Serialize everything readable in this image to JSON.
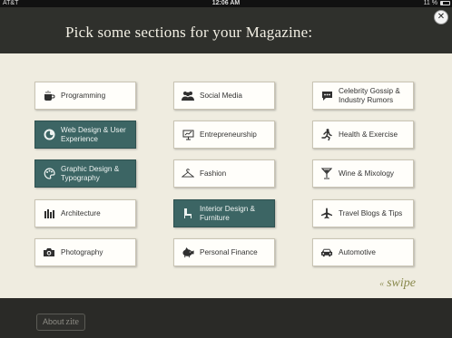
{
  "status_bar": {
    "carrier": "AT&T",
    "time": "12:06 AM",
    "battery": "11 %"
  },
  "header": {
    "title": "Pick some sections for your Magazine:",
    "close_label": "✕"
  },
  "sections": [
    {
      "label": "Programming",
      "selected": false,
      "icon": "coffee-icon"
    },
    {
      "label": "Social Media",
      "selected": false,
      "icon": "people-icon"
    },
    {
      "label": "Celebrity Gossip & Industry Rumors",
      "selected": false,
      "icon": "speech-bubble-icon"
    },
    {
      "label": "Web Design & User Experience",
      "selected": true,
      "icon": "firefox-icon"
    },
    {
      "label": "Entrepreneurship",
      "selected": false,
      "icon": "presentation-board-icon"
    },
    {
      "label": "Health & Exercise",
      "selected": false,
      "icon": "running-man-icon"
    },
    {
      "label": "Graphic Design & Typography",
      "selected": true,
      "icon": "palette-icon"
    },
    {
      "label": "Fashion",
      "selected": false,
      "icon": "hanger-icon"
    },
    {
      "label": "Wine & Mixology",
      "selected": false,
      "icon": "cocktail-glass-icon"
    },
    {
      "label": "Architecture",
      "selected": false,
      "icon": "building-icon"
    },
    {
      "label": "Interior Design & Furniture",
      "selected": true,
      "icon": "chair-icon"
    },
    {
      "label": "Travel Blogs & Tips",
      "selected": false,
      "icon": "airplane-icon"
    },
    {
      "label": "Photography",
      "selected": false,
      "icon": "camera-icon"
    },
    {
      "label": "Personal Finance",
      "selected": false,
      "icon": "piggy-bank-icon"
    },
    {
      "label": "Automotive",
      "selected": false,
      "icon": "car-icon"
    }
  ],
  "pager": {
    "count": 3,
    "active": 1
  },
  "swipe": {
    "arrow": "«",
    "label": "swipe"
  },
  "footer": {
    "about_label": "About",
    "brand": "zite"
  },
  "colors": {
    "selected_card": "#3c6564",
    "header_bg": "#2f302c",
    "content_bg": "#efece0",
    "swipe_text": "#8a8a4e"
  }
}
